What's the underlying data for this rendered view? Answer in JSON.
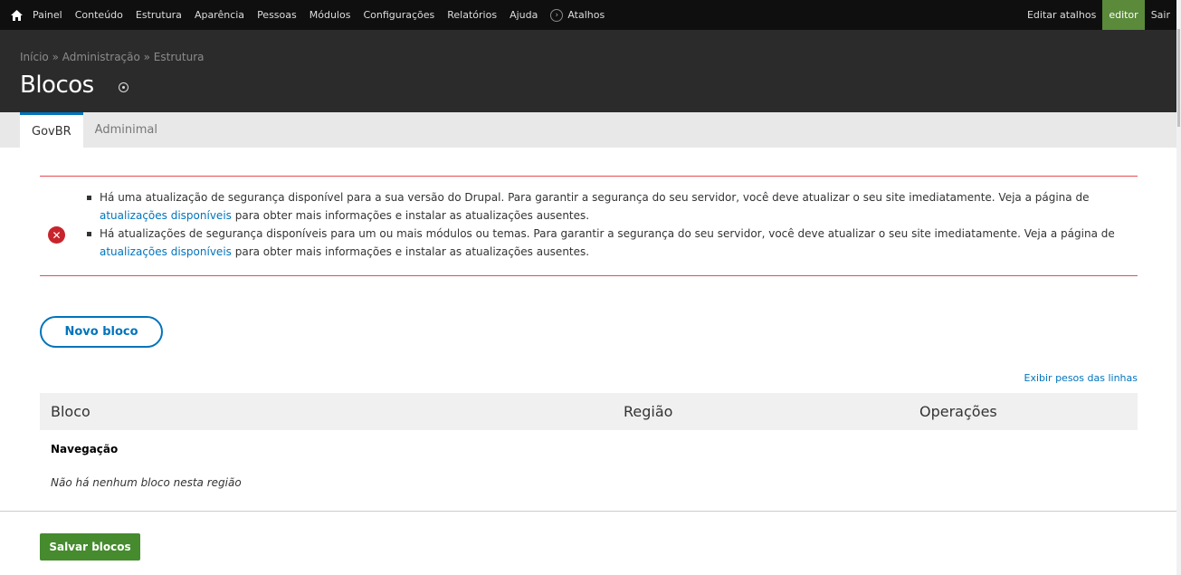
{
  "toolbar": {
    "items": [
      "Painel",
      "Conteúdo",
      "Estrutura",
      "Aparência",
      "Pessoas",
      "Módulos",
      "Configurações",
      "Relatórios",
      "Ajuda"
    ],
    "shortcuts_label": "Atalhos",
    "edit_shortcuts": "Editar atalhos",
    "user": "editor",
    "logout": "Sair"
  },
  "breadcrumb": "Início » Administração » Estrutura",
  "page_title": "Blocos",
  "tabs": [
    {
      "label": "GovBR",
      "active": true
    },
    {
      "label": "Adminimal",
      "active": false
    }
  ],
  "messages": {
    "items": [
      {
        "text_before": "Há uma atualização de segurança disponível para a sua versão do Drupal. Para garantir a segurança do seu servidor, você deve atualizar o seu site imediatamente. Veja a página de ",
        "link": "atualizações disponíveis",
        "text_after": " para obter mais informações e instalar as atualizações ausentes."
      },
      {
        "text_before": "Há atualizações de segurança disponíveis para um ou mais módulos ou temas. Para garantir a segurança do seu servidor, você deve atualizar o seu site imediatamente. Veja a página de ",
        "link": "atualizações disponíveis",
        "text_after": " para obter mais informações e instalar as atualizações ausentes."
      }
    ]
  },
  "new_block_button": "Novo bloco",
  "show_weights_link": "Exibir pesos das linhas",
  "table": {
    "headers": {
      "block": "Bloco",
      "region": "Região",
      "operations": "Operações"
    },
    "region_title": "Navegação",
    "empty_text": "Não há nenhum bloco nesta região"
  },
  "save_button": "Salvar blocos",
  "colors": {
    "accent": "#0074bd",
    "error": "#e64d54",
    "save": "#468b2e"
  }
}
